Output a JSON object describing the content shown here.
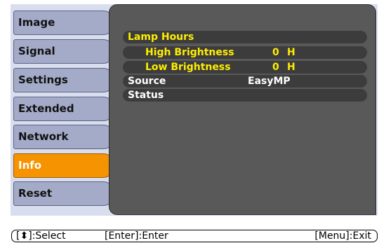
{
  "menu": {
    "items": [
      {
        "label": "Image"
      },
      {
        "label": "Signal"
      },
      {
        "label": "Settings"
      },
      {
        "label": "Extended"
      },
      {
        "label": "Network"
      },
      {
        "label": "Info"
      },
      {
        "label": "Reset"
      }
    ],
    "selected": "Info"
  },
  "info": {
    "lamp_hours_label": "Lamp Hours",
    "high_brightness_label": "High Brightness",
    "high_brightness_value": "0",
    "high_brightness_unit": "H",
    "low_brightness_label": "Low Brightness",
    "low_brightness_value": "0",
    "low_brightness_unit": "H",
    "source_label": "Source",
    "source_value": "EasyMP",
    "status_label": "Status"
  },
  "footer": {
    "select_hint": "[⬍]:Select",
    "enter_hint": "[Enter]:Enter",
    "exit_hint": "[Menu]:Exit"
  },
  "colors": {
    "active_tab": "#f59300",
    "inactive_tab": "#a4abc9",
    "panel": "#595959",
    "highlight_text": "#ffee00"
  }
}
